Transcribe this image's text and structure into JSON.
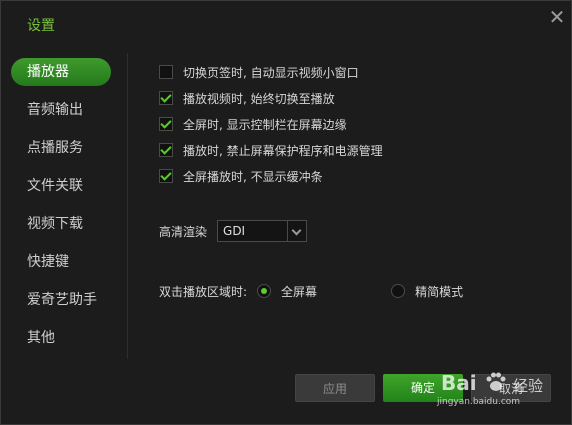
{
  "window": {
    "title": "设置"
  },
  "sidebar": {
    "items": [
      {
        "label": "播放器",
        "active": true
      },
      {
        "label": "音频输出",
        "active": false
      },
      {
        "label": "点播服务",
        "active": false
      },
      {
        "label": "文件关联",
        "active": false
      },
      {
        "label": "视频下载",
        "active": false
      },
      {
        "label": "快捷键",
        "active": false
      },
      {
        "label": "爱奇艺助手",
        "active": false
      },
      {
        "label": "其他",
        "active": false
      }
    ]
  },
  "player_options": [
    {
      "label": "切换页签时, 自动显示视频小窗口",
      "checked": false
    },
    {
      "label": "播放视频时, 始终切换至播放",
      "checked": true
    },
    {
      "label": "全屏时, 显示控制栏在屏幕边缘",
      "checked": true
    },
    {
      "label": "播放时, 禁止屏幕保护程序和电源管理",
      "checked": true
    },
    {
      "label": "全屏播放时, 不显示缓冲条",
      "checked": true
    }
  ],
  "render": {
    "label": "高清渲染",
    "value": "GDI"
  },
  "double_click": {
    "label": "双击播放区域时:",
    "options": [
      {
        "label": "全屏幕",
        "selected": true
      },
      {
        "label": "精简模式",
        "selected": false
      }
    ]
  },
  "buttons": {
    "apply": "应用",
    "ok": "确定",
    "cancel": "取消"
  },
  "watermark": {
    "logo": "Bai",
    "suffix": "经验",
    "url": "jingyan.baidu.com"
  },
  "colors": {
    "accent": "#5ccb2d",
    "title": "#79c13b",
    "active_nav": "#2f8a22"
  }
}
